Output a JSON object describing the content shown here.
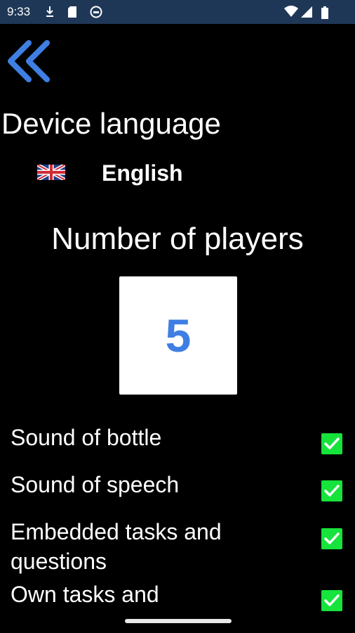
{
  "status_bar": {
    "time": "9:33",
    "icons": [
      "download-icon",
      "sd-card-icon",
      "app-icon",
      "wifi-icon",
      "signal-icon",
      "battery-icon"
    ]
  },
  "nav": {
    "back_icon": "double-chevron-left-icon",
    "accent_color": "#3f7fe3"
  },
  "language": {
    "title": "Device language",
    "flag": "uk-flag-icon",
    "value": "English"
  },
  "players": {
    "title": "Number of players",
    "count": "5"
  },
  "options": [
    {
      "label": "Sound of bottle",
      "checked": true
    },
    {
      "label": "Sound of speech",
      "checked": true
    },
    {
      "label": "Embedded tasks and questions",
      "checked": true
    },
    {
      "label": "Own tasks and",
      "checked": true
    }
  ],
  "colors": {
    "background": "#000000",
    "checkbox": "#16e33b",
    "status_bar": "#1f3757"
  }
}
